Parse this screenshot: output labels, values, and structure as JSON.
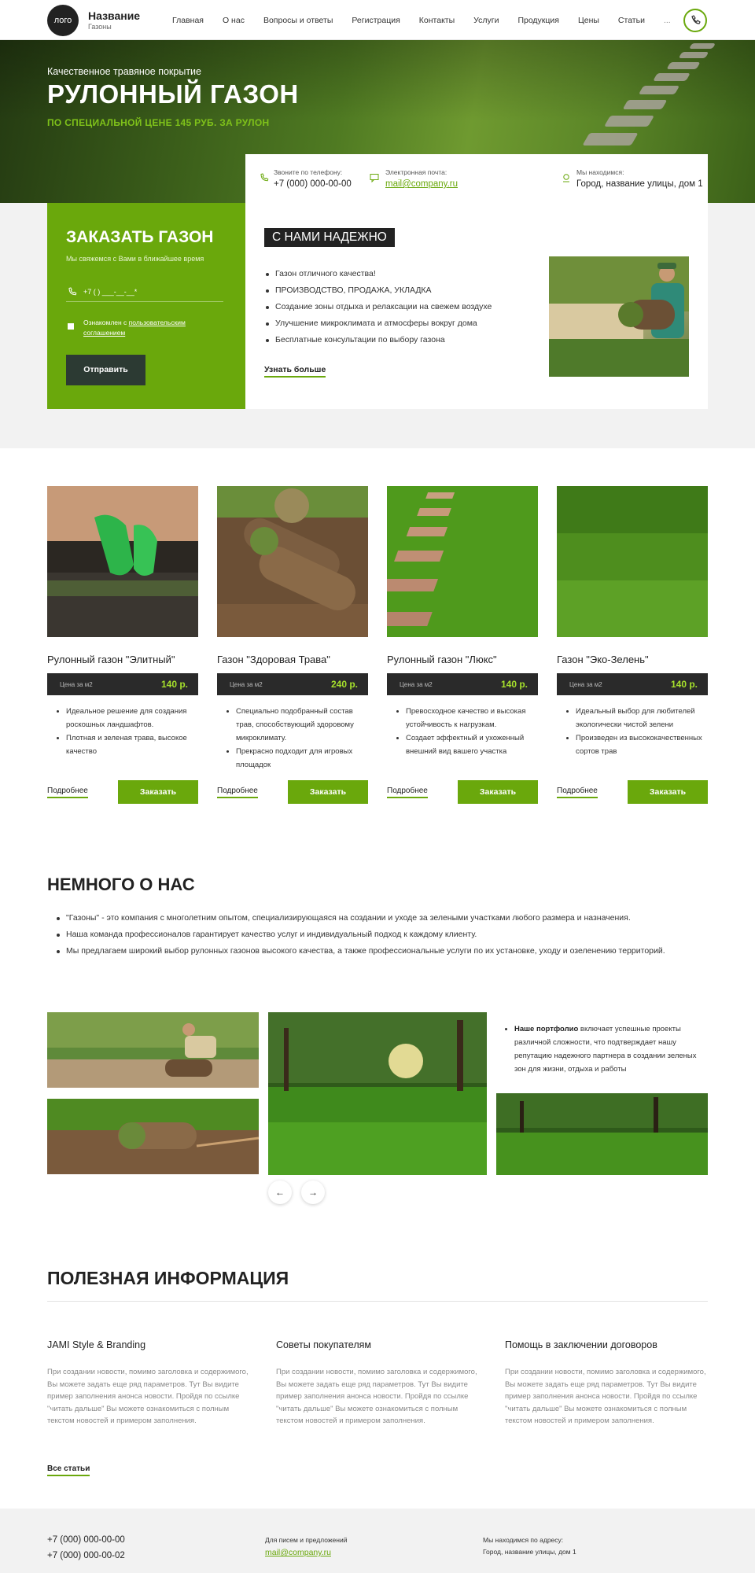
{
  "header": {
    "logo": "лого",
    "brand_name": "Название",
    "brand_sub": "Газоны",
    "nav": [
      "Главная",
      "О нас",
      "Вопросы и ответы",
      "Регистрация",
      "Контакты",
      "Услуги",
      "Продукция",
      "Цены",
      "Статьи",
      "..."
    ],
    "phone_icon": "phone-icon"
  },
  "hero": {
    "kicker": "Качественное травяное покрытие",
    "title": "РУЛОННЫЙ ГАЗОН",
    "price_line": "ПО СПЕЦИАЛЬНОЙ ЦЕНЕ 145 РУБ. ЗА РУЛОН"
  },
  "contacts": {
    "phone_label": "Звоните по телефону:",
    "phone": "+7 (000) 000-00-00",
    "email_label": "Электронная почта:",
    "email": "mail@company.ru",
    "address_label": "Мы находимся:",
    "address": "Город, название улицы, дом 1"
  },
  "order": {
    "title": "ЗАКАЗАТЬ ГАЗОН",
    "subtitle": "Мы свяжемся с Вами в ближайшее время",
    "phone_placeholder": "+7 (   ) ___-__-__*",
    "agree_prefix": "Ознакомлен с ",
    "agree_link": "пользовательским соглашением",
    "submit": "Отправить"
  },
  "reliable": {
    "title": "С НАМИ НАДЕЖНО",
    "items": [
      "Газон отличного качества!",
      "ПРОИЗВОДСТВО, ПРОДАЖА, УКЛАДКА",
      "Создание зоны отдыха и релаксации на свежем воздухе",
      "Улучшение микроклимата и атмосферы вокруг дома",
      "Бесплатные консультации по выбору газона"
    ],
    "more": "Узнать больше"
  },
  "products": [
    {
      "title": "Рулонный газон \"Элитный\"",
      "price_label": "Цена за м2",
      "price": "140 р.",
      "features": [
        "Идеальное решение для создания роскошных ландшафтов.",
        "Плотная и зеленая трава, высокое качество"
      ],
      "more": "Подробнее",
      "order": "Заказать"
    },
    {
      "title": "Газон \"Здоровая Трава\"",
      "price_label": "Цена за м2",
      "price": "240 р.",
      "features": [
        "Специально подобранный состав трав, способствующий здоровому микроклимату.",
        "Прекрасно подходит для игровых площадок"
      ],
      "more": "Подробнее",
      "order": "Заказать"
    },
    {
      "title": "Рулонный газон \"Люкс\"",
      "price_label": "Цена за м2",
      "price": "140 р.",
      "features": [
        "Превосходное качество и высокая устойчивость к нагрузкам.",
        "Создает эффектный и ухоженный внешний вид вашего участка"
      ],
      "more": "Подробнее",
      "order": "Заказать"
    },
    {
      "title": "Газон \"Эко-Зелень\"",
      "price_label": "Цена за м2",
      "price": "140 р.",
      "features": [
        "Идеальный выбор для любителей экологически чистой зелени",
        "Произведен из высококачественных сортов трав"
      ],
      "more": "Подробнее",
      "order": "Заказать"
    }
  ],
  "about": {
    "title": "НЕМНОГО О НАС",
    "items": [
      "\"Газоны\" - это компания с многолетним опытом, специализирующаяся на создании и уходе за зелеными участками любого размера и назначения.",
      "Наша команда профессионалов гарантирует качество услуг и индивидуальный подход к каждому клиенту.",
      "Мы предлагаем широкий выбор рулонных газонов высокого качества, а также профессиональные услуги по их установке, уходу и озеленению территорий."
    ],
    "portfolio_bold": "Наше портфолио",
    "portfolio_text": " включает успешные проекты различной сложности, что подтверждает нашу репутацию надежного партнера в создании зеленых зон для жизни, отдыха и работы",
    "prev": "←",
    "next": "→"
  },
  "info": {
    "title": "ПОЛЕЗНАЯ ИНФОРМАЦИЯ",
    "articles": [
      {
        "title": "JAMI Style & Branding",
        "text": "При создании новости, помимо заголовка и содержимого, Вы можете задать еще ряд параметров. Тут Вы видите пример заполнения анонса новости. Пройдя по ссылке \"читать дальше\" Вы можете ознакомиться с полным текстом новостей и примером заполнения."
      },
      {
        "title": "Советы покупателям",
        "text": "При создании новости, помимо заголовка и содержимого, Вы можете задать еще ряд параметров. Тут Вы видите пример заполнения анонса новости. Пройдя по ссылке \"читать дальше\" Вы можете ознакомиться с полным текстом новостей и примером заполнения."
      },
      {
        "title": "Помощь в заключении договоров",
        "text": "При создании новости, помимо заголовка и содержимого, Вы можете задать еще ряд параметров. Тут Вы видите пример заполнения анонса новости. Пройдя по ссылке \"читать дальше\" Вы можете ознакомиться с полным текстом новостей и примером заполнения."
      }
    ],
    "all": "Все статьи"
  },
  "footer": {
    "phone1": "+7 (000) 000-00-00",
    "phone2": "+7 (000) 000-00-02",
    "mail_label": "Для писем и предложений",
    "mail": "mail@company.ru",
    "address_label": "Мы находимся по адресу:",
    "address": "Город, название улицы, дом 1"
  },
  "colors": {
    "accent": "#6aa80c",
    "dark": "#2a2a2a",
    "price": "#a6e02c"
  }
}
